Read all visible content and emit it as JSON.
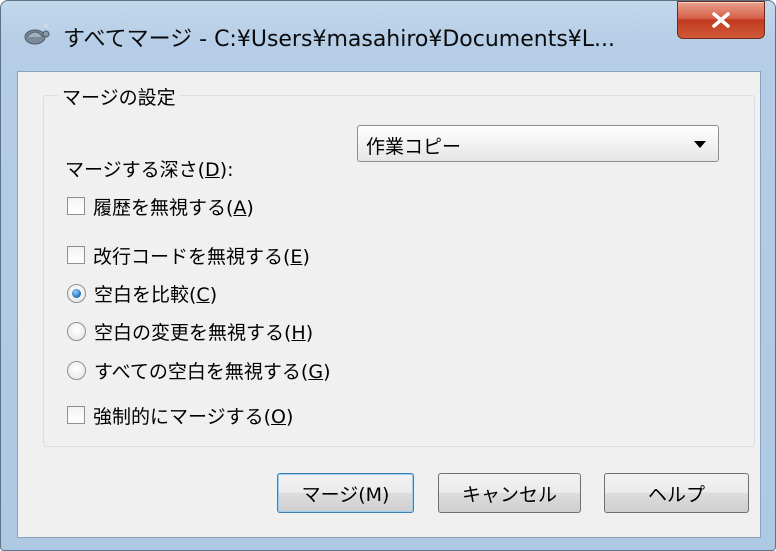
{
  "window": {
    "title": "すべてマージ - C:¥Users¥masahiro¥Documents¥L...",
    "close_label": "X"
  },
  "group": {
    "legend": "マージの設定"
  },
  "depth": {
    "label_prefix": "マージする深さ(",
    "label_key": "D",
    "label_suffix": "):",
    "selected": "作業コピー"
  },
  "options": {
    "ignore_history": {
      "prefix": "履歴を無視する(",
      "key": "A",
      "suffix": ")",
      "checked": false
    },
    "ignore_eol": {
      "prefix": "改行コードを無視する(",
      "key": "E",
      "suffix": ")",
      "checked": false
    },
    "compare_whitespace": {
      "prefix": "空白を比較(",
      "key": "C",
      "suffix": ")",
      "selected": true
    },
    "ignore_ws_changes": {
      "prefix": "空白の変更を無視する(",
      "key": "H",
      "suffix": ")",
      "selected": false
    },
    "ignore_all_ws": {
      "prefix": "すべての空白を無視する(",
      "key": "G",
      "suffix": ")",
      "selected": false
    },
    "force_merge": {
      "prefix": "強制的にマージする(",
      "key": "O",
      "suffix": ")",
      "checked": false
    }
  },
  "buttons": {
    "merge": "マージ(M)",
    "cancel": "キャンセル",
    "help": "ヘルプ"
  },
  "icons": {
    "app": "tortoise-icon",
    "close": "close-icon"
  },
  "colors": {
    "window_frame": "#aec9e3",
    "close_button": "#c23a1f",
    "dialog_bg": "#f0f0f0",
    "radio_selected": "#1b6bb8"
  }
}
